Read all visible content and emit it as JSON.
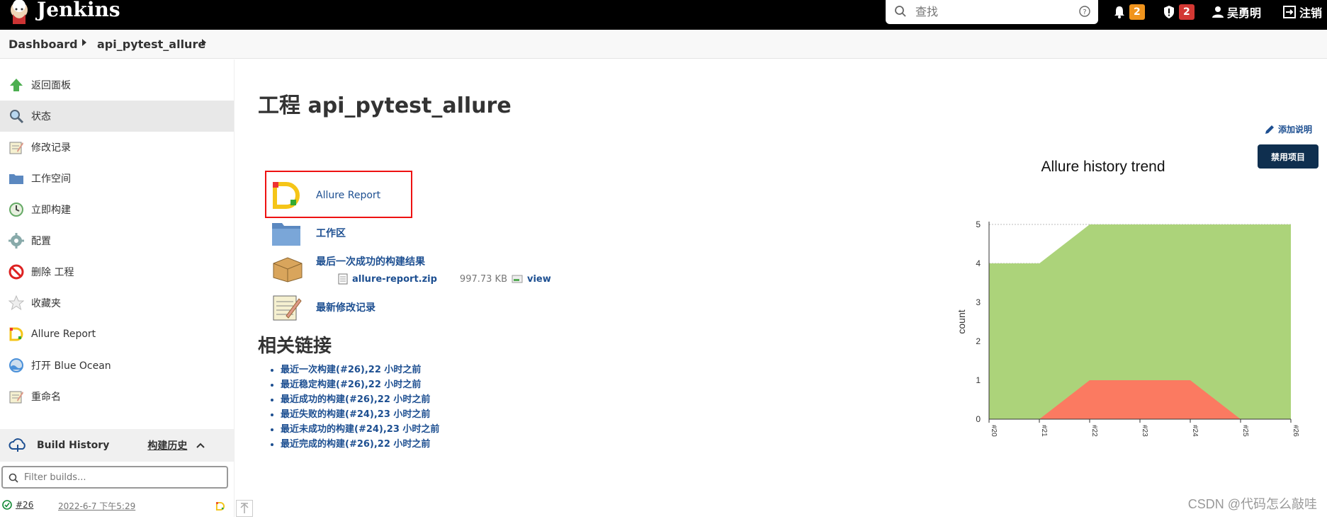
{
  "header": {
    "brand": "Jenkins",
    "search_placeholder": "查找",
    "notifications_count": "2",
    "security_count": "2",
    "user_name": "吴勇明",
    "logout_label": "注销"
  },
  "breadcrumbs": [
    "Dashboard",
    "api_pytest_allure"
  ],
  "sidebar": {
    "items": [
      {
        "label": "返回面板",
        "icon": "up-arrow-icon"
      },
      {
        "label": "状态",
        "icon": "search-icon"
      },
      {
        "label": "修改记录",
        "icon": "notepad-icon"
      },
      {
        "label": "工作空间",
        "icon": "folder-icon"
      },
      {
        "label": "立即构建",
        "icon": "clock-build-icon"
      },
      {
        "label": "配置",
        "icon": "gear-icon"
      },
      {
        "label": "删除 工程",
        "icon": "no-entry-icon"
      },
      {
        "label": "收藏夹",
        "icon": "star-icon"
      },
      {
        "label": "Allure Report",
        "icon": "allure-icon"
      },
      {
        "label": "打开 Blue Ocean",
        "icon": "blue-ocean-icon"
      },
      {
        "label": "重命名",
        "icon": "rename-icon"
      }
    ],
    "build_history": {
      "title": "Build History",
      "link": "构建历史",
      "filter_placeholder": "Filter builds...",
      "builds": [
        {
          "number": "#26",
          "date": "2022-6-7 下午5:29"
        }
      ]
    }
  },
  "main": {
    "title": "工程 api_pytest_allure",
    "add_description": "添加说明",
    "disable_button": "禁用项目",
    "links": {
      "allure": "Allure Report",
      "workspace": "工作区",
      "last_success": "最后一次成功的构建结果",
      "artifact_file": "allure-report.zip",
      "artifact_size": "997.73 KB",
      "artifact_view": "view",
      "changes": "最新修改记录"
    },
    "related_title": "相关链接",
    "related_links": [
      "最近一次构建(#26),22 小时之前",
      "最近稳定构建(#26),22 小时之前",
      "最近成功的构建(#26),22 小时之前",
      "最近失败的构建(#24),23 小时之前",
      "最近未成功的构建(#24),23 小时之前",
      "最近完成的构建(#26),22 小时之前"
    ]
  },
  "chart_data": {
    "type": "area",
    "title": "Allure history trend",
    "ylabel": "count",
    "xlabel": "",
    "x": [
      "#20",
      "#21",
      "#22",
      "#23",
      "#24",
      "#25",
      "#26"
    ],
    "series": [
      {
        "values": [
          4,
          4,
          5,
          5,
          5,
          5,
          5
        ],
        "color": "#acd37a"
      },
      {
        "values": [
          0,
          0,
          1,
          1,
          1,
          0,
          0
        ],
        "color": "#fb7a61"
      }
    ],
    "ylim": [
      0,
      5
    ],
    "yticks": [
      0,
      1,
      2,
      3,
      4,
      5
    ],
    "grid": true
  },
  "watermark": "CSDN @代码怎么敲哇"
}
